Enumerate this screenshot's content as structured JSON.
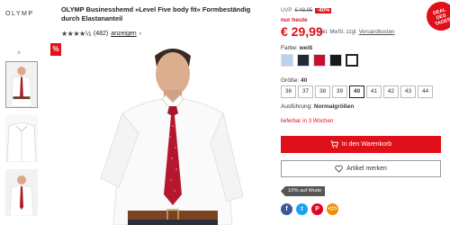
{
  "brand": "OLYMP",
  "product": {
    "title": "OLYMP Businesshemd »Level Five body fit« Formbeständig durch Elastananteil",
    "rating_stars": "★★★★½",
    "review_count": "(482)",
    "reviews_link": "anzeigen",
    "reviews_chevron": "›"
  },
  "badges": {
    "sale": "%",
    "deal_line1": "DEAL",
    "deal_line2": "DES",
    "deal_line3": "TAGES"
  },
  "thumbs_up_icon": "˄",
  "pricing": {
    "uvp_label": "UVP",
    "uvp_old": "€ 49,95",
    "discount": "-40%",
    "today_label": "nur heute",
    "price": "€ 29,99",
    "vat_text": "inkl. MwSt. zzgl.",
    "shipping_link": "Versandkosten"
  },
  "color": {
    "label": "Farbe:",
    "value": "weiß",
    "swatches": [
      "#b9d3ee",
      "#222a3a",
      "#c8102e",
      "#1a1a1a",
      "#ffffff"
    ]
  },
  "size": {
    "label": "Größe:",
    "value": "40",
    "options": [
      "36",
      "37",
      "38",
      "39",
      "40",
      "41",
      "42",
      "43",
      "44"
    ]
  },
  "fit": {
    "label": "Ausführung:",
    "value": "Normalgrößen"
  },
  "delivery": "lieferbar in 3 Wochen",
  "actions": {
    "cart": "In den Warenkorb",
    "wishlist": "Artikel merken"
  },
  "promo_tag": "10% auf Mode",
  "share": [
    {
      "name": "facebook",
      "glyph": "f",
      "color": "#3b5998"
    },
    {
      "name": "twitter",
      "glyph": "t",
      "color": "#1da1f2"
    },
    {
      "name": "pinterest",
      "glyph": "P",
      "color": "#e60023"
    },
    {
      "name": "embed",
      "glyph": "</>",
      "color": "#f28c00"
    }
  ]
}
